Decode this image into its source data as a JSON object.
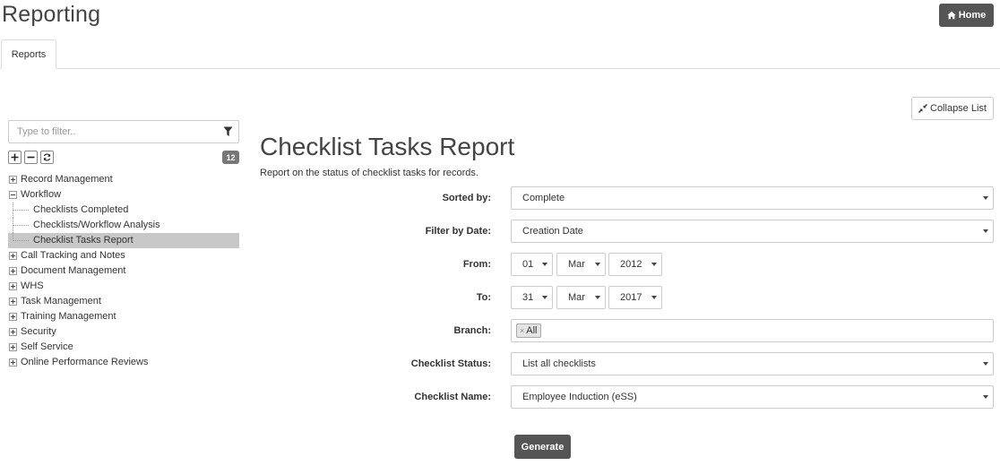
{
  "header": {
    "title": "Reporting",
    "home_label": "Home"
  },
  "tabs": [
    {
      "label": "Reports",
      "active": true
    }
  ],
  "collapse_label": "Collapse List",
  "sidebar": {
    "filter_placeholder": "Type to filter..",
    "count": "12",
    "tree": [
      {
        "label": "Record Management",
        "expanded": false
      },
      {
        "label": "Workflow",
        "expanded": true,
        "children": [
          {
            "label": "Checklists Completed"
          },
          {
            "label": "Checklists/Workflow Analysis"
          },
          {
            "label": "Checklist Tasks Report",
            "selected": true
          }
        ]
      },
      {
        "label": "Call Tracking and Notes",
        "expanded": false
      },
      {
        "label": "Document Management",
        "expanded": false
      },
      {
        "label": "WHS",
        "expanded": false
      },
      {
        "label": "Task Management",
        "expanded": false
      },
      {
        "label": "Training Management",
        "expanded": false
      },
      {
        "label": "Security",
        "expanded": false
      },
      {
        "label": "Self Service",
        "expanded": false
      },
      {
        "label": "Online Performance Reviews",
        "expanded": false
      }
    ]
  },
  "report": {
    "title": "Checklist Tasks Report",
    "description": "Report on the status of checklist tasks for records.",
    "fields": {
      "sorted_by": {
        "label": "Sorted by:",
        "value": "Complete"
      },
      "filter_by_date": {
        "label": "Filter by Date:",
        "value": "Creation Date"
      },
      "from": {
        "label": "From:",
        "day": "01",
        "month": "Mar",
        "year": "2012"
      },
      "to": {
        "label": "To:",
        "day": "31",
        "month": "Mar",
        "year": "2017"
      },
      "branch": {
        "label": "Branch:",
        "tag": "All",
        "tag_remove": "×"
      },
      "checklist_status": {
        "label": "Checklist Status:",
        "value": "List all checklists"
      },
      "checklist_name": {
        "label": "Checklist Name:",
        "value": "Employee Induction (eSS)"
      }
    },
    "generate_label": "Generate"
  }
}
